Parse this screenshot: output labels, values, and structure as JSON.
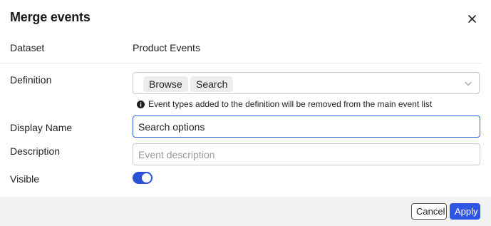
{
  "dialog": {
    "title": "Merge events"
  },
  "fields": {
    "dataset_label": "Dataset",
    "dataset_value": "Product Events",
    "definition_label": "Definition",
    "definition_chips": [
      "Browse",
      "Search"
    ],
    "definition_hint": "Event types added to the definition will be removed from the main event list",
    "display_name_label": "Display Name",
    "display_name_value": "Search options",
    "description_label": "Description",
    "description_placeholder": "Event description",
    "visible_label": "Visible",
    "visible_on": true
  },
  "footer": {
    "cancel_label": "Cancel",
    "apply_label": "Apply"
  },
  "colors": {
    "accent": "#2f55e3",
    "toggle_on": "#2b51d9",
    "focus_border": "#2f5fd7"
  },
  "icons": {
    "close": "close-icon",
    "chevron": "chevron-down-icon",
    "info": "info-icon"
  }
}
